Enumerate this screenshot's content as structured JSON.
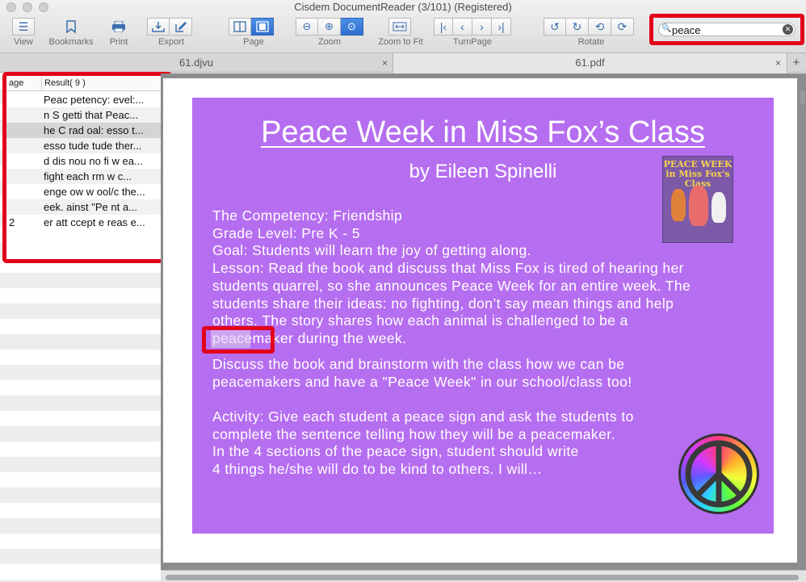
{
  "window": {
    "title": "Cisdem DocumentReader (3/101) (Registered)"
  },
  "toolbar": {
    "view_label": "View",
    "bookmarks_label": "Bookmarks",
    "print_label": "Print",
    "export_label": "Export",
    "page_label": "Page",
    "zoom_label": "Zoom",
    "zoom_to_fit_label": "Zoom to Fit",
    "turnpage_label": "TurnPage",
    "rotate_label": "Rotate"
  },
  "search": {
    "value": "peace",
    "clear_glyph": "✕",
    "icon": "search-icon"
  },
  "tabs": [
    {
      "label": "61.djvu",
      "close": "×"
    },
    {
      "label": "61.pdf",
      "close": "×"
    }
  ],
  "tab_add": "+",
  "results": {
    "header_page": "age",
    "header_result": "Result( 9 )",
    "rows": [
      {
        "page": "",
        "text": "Peac petency:  evel:..."
      },
      {
        "page": "",
        "text": "n S getti that  Peac..."
      },
      {
        "page": "",
        "text": "he C rad oal: esso t..."
      },
      {
        "page": "",
        "text": "esso tude tude ther..."
      },
      {
        "page": "",
        "text": "d dis nou  no fi w ea..."
      },
      {
        "page": "",
        "text": " fight each   rm w c..."
      },
      {
        "page": "",
        "text": "enge ow w ool/c the..."
      },
      {
        "page": "",
        "text": "eek.  ainst  \"Pe nt a..."
      },
      {
        "page": "2",
        "text": "er att ccept e reas e..."
      }
    ]
  },
  "slide": {
    "title": "Peace Week in Miss Fox’s Class",
    "author": "by Eileen Spinelli",
    "book_cover_title": "PEACE WEEK\nin Miss Fox's Class",
    "lines_block1": [
      "The Competency: Friendship",
      "Grade Level: Pre K - 5",
      "Goal:  Students will learn the joy of getting along.",
      "Lesson:  Read the book and discuss that Miss Fox is tired of hearing her",
      "students quarrel, so she announces Peace Week for an entire week. The",
      "students share their ideas: no fighting, don’t say mean things and help",
      "others. The story shares how each animal is challenged to be a",
      "peacemaker during the week."
    ],
    "lines_block2": [
      "Discuss the book and brainstorm with the class how we can be",
      "peacemakers and have a \"Peace Week\" in our school/class too!"
    ],
    "lines_block3": [
      "Activity: Give each student a peace sign and ask the students to",
      "complete the sentence telling how they will be a peacemaker.",
      "In the 4 sections of the peace sign, student should write",
      "4 things he/she will do to be kind to others.  I will…"
    ]
  }
}
